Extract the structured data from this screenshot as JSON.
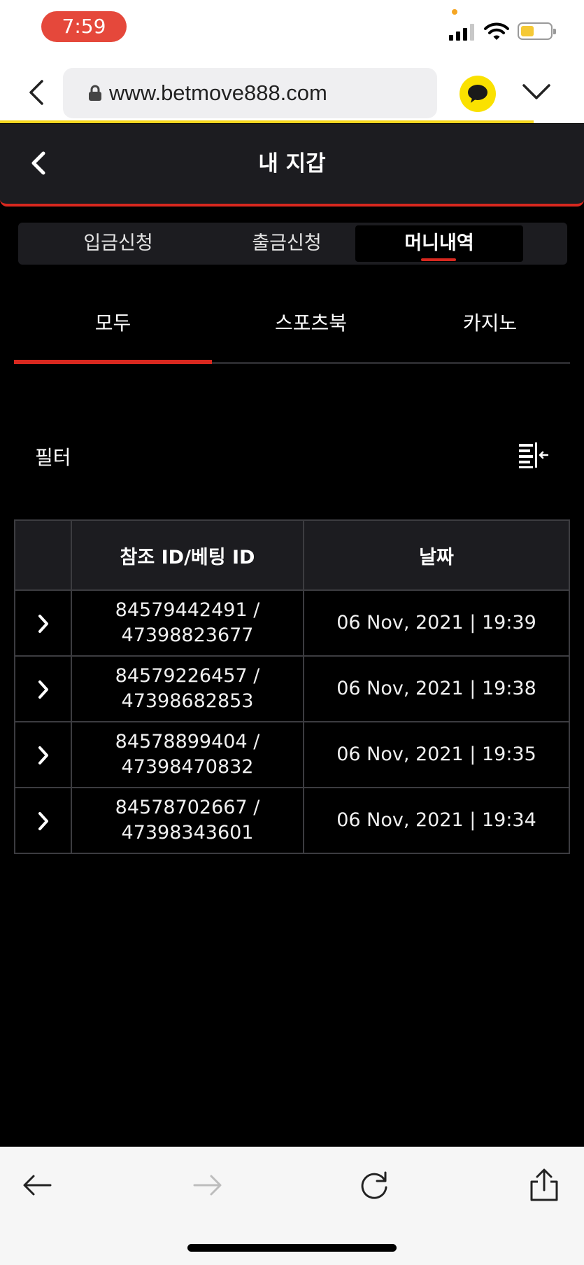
{
  "status_bar": {
    "time": "7:59",
    "colors": {
      "time_pill": "#e5483b",
      "battery": "#f5c936"
    }
  },
  "browser": {
    "url": "www.betmove888.com",
    "icons": [
      "back-icon",
      "lock-icon",
      "kakaotalk-icon",
      "chevron-down-icon"
    ],
    "load_bar_color": "#f5d51e"
  },
  "header": {
    "title": "내 지갑",
    "accent": "#d8281f"
  },
  "wallet_tabs": [
    {
      "label": "입금신청",
      "active": false
    },
    {
      "label": "출금신청",
      "active": false
    },
    {
      "label": "머니내역",
      "active": true
    }
  ],
  "category_tabs": [
    {
      "label": "모두",
      "active": true
    },
    {
      "label": "스포츠북",
      "active": false
    },
    {
      "label": "카지노",
      "active": false
    }
  ],
  "filter": {
    "label": "필터",
    "icon": "filter-collapse-icon"
  },
  "table": {
    "headers": [
      "",
      "참조 ID/베팅 ID",
      "날짜"
    ],
    "rows": [
      {
        "ref_id": "84579442491 /",
        "bet_id": "47398823677",
        "date": "06 Nov, 2021 | 19:39"
      },
      {
        "ref_id": "84579226457 /",
        "bet_id": "47398682853",
        "date": "06 Nov, 2021 | 19:38"
      },
      {
        "ref_id": "84578899404 /",
        "bet_id": "47398470832",
        "date": "06 Nov, 2021 | 19:35"
      },
      {
        "ref_id": "84578702667 /",
        "bet_id": "47398343601",
        "date": "06 Nov, 2021 | 19:34"
      }
    ]
  },
  "toolbar": {
    "icons": [
      "back-arrow-icon",
      "forward-arrow-icon",
      "reload-icon",
      "share-icon"
    ]
  }
}
